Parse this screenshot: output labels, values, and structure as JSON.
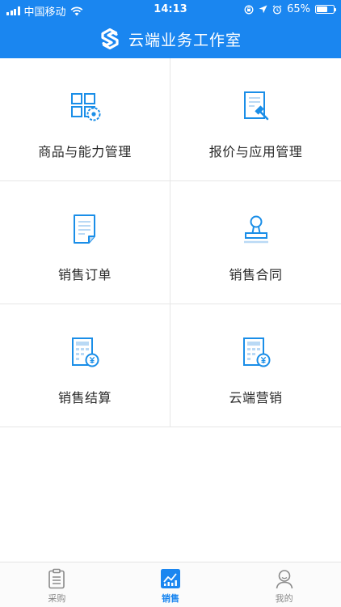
{
  "status_bar": {
    "carrier": "中国移动",
    "time": "14:13",
    "battery_percent": "65%",
    "battery_level": 0.65
  },
  "nav": {
    "title": "云端业务工作室",
    "logo_icon": "s-logo-icon"
  },
  "grid": [
    {
      "label": "商品与能力管理",
      "icon": "product-grid-gear-icon"
    },
    {
      "label": "报价与应用管理",
      "icon": "document-hammer-icon"
    },
    {
      "label": "销售订单",
      "icon": "order-document-icon"
    },
    {
      "label": "销售合同",
      "icon": "stamp-icon"
    },
    {
      "label": "销售结算",
      "icon": "calculator-yen-icon"
    },
    {
      "label": "云端营销",
      "icon": "calculator-yen-icon"
    }
  ],
  "tabs": [
    {
      "label": "采购",
      "icon": "clipboard-icon",
      "active": false
    },
    {
      "label": "销售",
      "icon": "chart-icon",
      "active": true
    },
    {
      "label": "我的",
      "icon": "user-icon",
      "active": false
    }
  ],
  "colors": {
    "brand": "#1a86f0",
    "icon_blue": "#1a8ee8",
    "tab_inactive": "#8a8a8a"
  }
}
